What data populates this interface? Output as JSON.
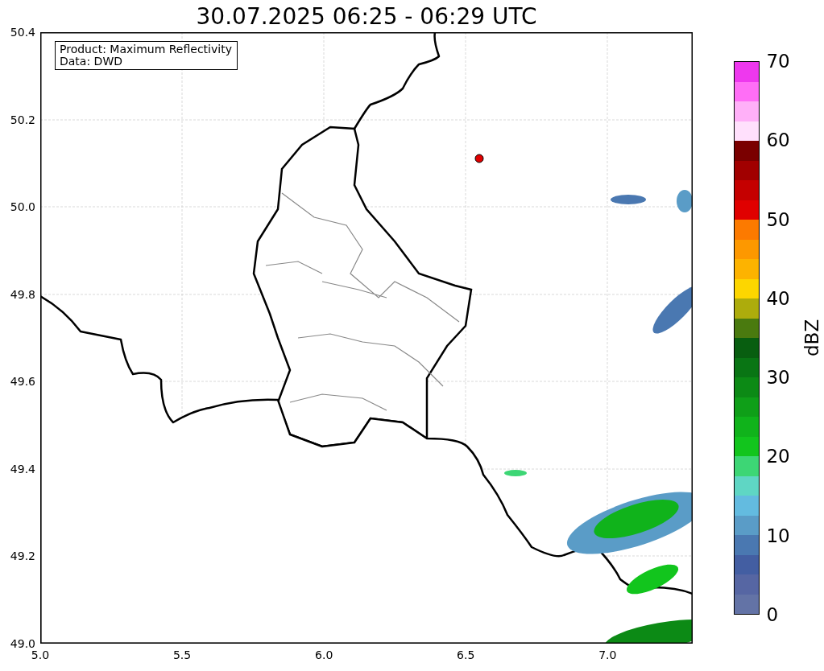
{
  "title": "30.07.2025 06:25 - 06:29 UTC",
  "map": {
    "info_box": [
      "Product: Maximum Reflectivity",
      "Data: DWD"
    ],
    "x_ticks": [
      "5.0",
      "5.5",
      "6.0",
      "6.5",
      "7.0"
    ],
    "y_ticks": [
      "50.4",
      "50.2",
      "50.0",
      "49.8",
      "49.6",
      "49.4",
      "49.2",
      "49.0"
    ]
  },
  "colorbar": {
    "label": "dBZ",
    "ticks": [
      "70",
      "60",
      "50",
      "40",
      "30",
      "20",
      "10",
      "0"
    ],
    "segments": [
      {
        "color": "#ee38ee"
      },
      {
        "color": "#ff6ef6"
      },
      {
        "color": "#ffb0f8"
      },
      {
        "color": "#ffe0fc"
      },
      {
        "color": "#7a0000"
      },
      {
        "color": "#a10000"
      },
      {
        "color": "#c50000"
      },
      {
        "color": "#e00000"
      },
      {
        "color": "#fc7a00"
      },
      {
        "color": "#fd9800"
      },
      {
        "color": "#fdb300"
      },
      {
        "color": "#fdd600"
      },
      {
        "color": "#adac0c"
      },
      {
        "color": "#4a7a0f"
      },
      {
        "color": "#085e10"
      },
      {
        "color": "#097514"
      },
      {
        "color": "#0c8a15"
      },
      {
        "color": "#0f9f18"
      },
      {
        "color": "#10b31b"
      },
      {
        "color": "#12c51d"
      },
      {
        "color": "#3dd675"
      },
      {
        "color": "#5fd6c4"
      },
      {
        "color": "#63bbe0"
      },
      {
        "color": "#5a9cc7"
      },
      {
        "color": "#4a78b1"
      },
      {
        "color": "#435ea2"
      },
      {
        "color": "#5666a3"
      },
      {
        "color": "#6373a6"
      }
    ]
  }
}
